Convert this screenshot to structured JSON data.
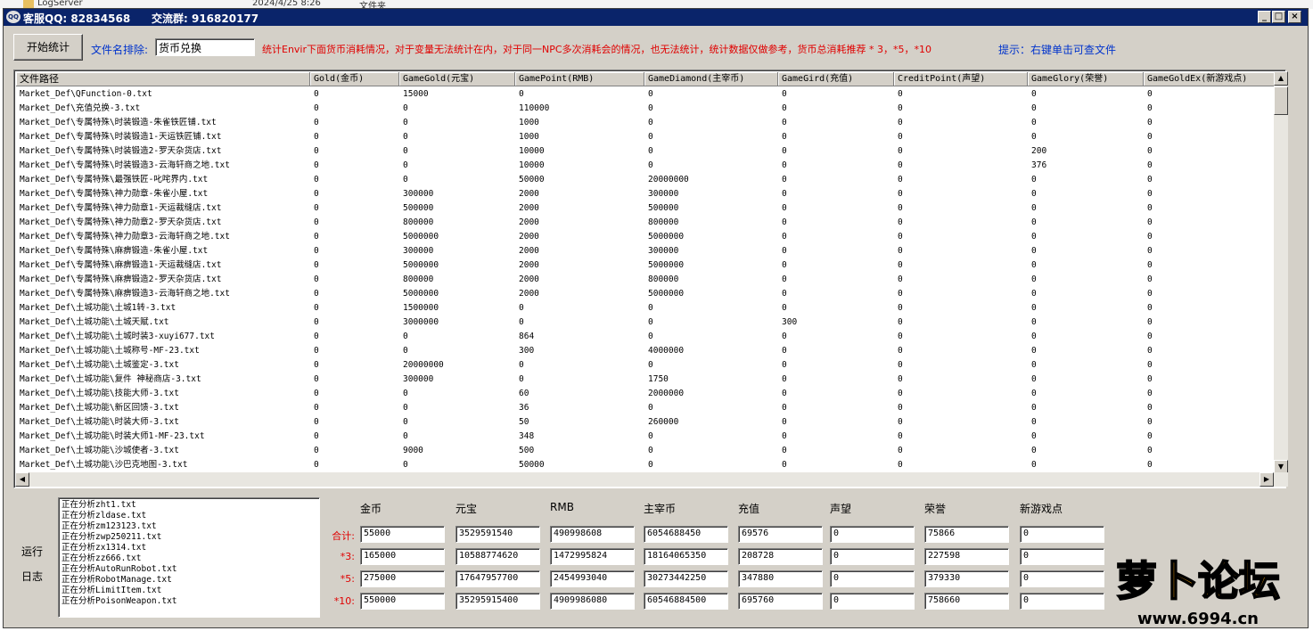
{
  "background": {
    "filename": "LogServer",
    "date": "2024/4/25 8:26",
    "type": "文件夹"
  },
  "titlebar": {
    "service_qq": "客服QQ: 82834568",
    "group": "交流群: 916820177",
    "min": "_",
    "max": "□",
    "close": "×"
  },
  "toolbar": {
    "start_label": "开始统计",
    "exclude_label": "文件名排除:",
    "exclude_value": "货币兑换",
    "note": "统计Envir下面货币消耗情况，对于变量无法统计在内，对于同一NPC多次消耗会的情况，也无法统计，统计数据仅做参考，货币总消耗推荐 * 3，*5，*10",
    "hint": "提示：右键单击可查文件"
  },
  "grid": {
    "columns": [
      "文件路径",
      "Gold(金币)",
      "GameGold(元宝)",
      "GamePoint(RMB)",
      "GameDiamond(主宰币)",
      "GameGird(充值)",
      "CreditPoint(声望)",
      "GameGlory(荣誉)",
      "GameGoldEx(新游戏点)"
    ],
    "rows": [
      [
        "Market_Def\\QFunction-0.txt",
        "0",
        "15000",
        "0",
        "0",
        "0",
        "0",
        "0",
        "0"
      ],
      [
        "Market_Def\\充值兑换-3.txt",
        "0",
        "0",
        "110000",
        "0",
        "0",
        "0",
        "0",
        "0"
      ],
      [
        "Market_Def\\专属特殊\\时装锻造-朱雀铁匠铺.txt",
        "0",
        "0",
        "1000",
        "0",
        "0",
        "0",
        "0",
        "0"
      ],
      [
        "Market_Def\\专属特殊\\时装锻造1-天运铁匠铺.txt",
        "0",
        "0",
        "1000",
        "0",
        "0",
        "0",
        "0",
        "0"
      ],
      [
        "Market_Def\\专属特殊\\时装锻造2-罗天杂货店.txt",
        "0",
        "0",
        "10000",
        "0",
        "0",
        "0",
        "200",
        "0"
      ],
      [
        "Market_Def\\专属特殊\\时装锻造3-云海轩商之地.txt",
        "0",
        "0",
        "10000",
        "0",
        "0",
        "0",
        "376",
        "0"
      ],
      [
        "Market_Def\\专属特殊\\最强铁匠-叱咤界内.txt",
        "0",
        "0",
        "50000",
        "20000000",
        "0",
        "0",
        "0",
        "0"
      ],
      [
        "Market_Def\\专属特殊\\神力勋章-朱雀小屋.txt",
        "0",
        "300000",
        "2000",
        "300000",
        "0",
        "0",
        "0",
        "0"
      ],
      [
        "Market_Def\\专属特殊\\神力勋章1-天运裁缝店.txt",
        "0",
        "500000",
        "2000",
        "500000",
        "0",
        "0",
        "0",
        "0"
      ],
      [
        "Market_Def\\专属特殊\\神力勋章2-罗天杂货店.txt",
        "0",
        "800000",
        "2000",
        "800000",
        "0",
        "0",
        "0",
        "0"
      ],
      [
        "Market_Def\\专属特殊\\神力勋章3-云海轩商之地.txt",
        "0",
        "5000000",
        "2000",
        "5000000",
        "0",
        "0",
        "0",
        "0"
      ],
      [
        "Market_Def\\专属特殊\\麻痹锻造-朱雀小屋.txt",
        "0",
        "300000",
        "2000",
        "300000",
        "0",
        "0",
        "0",
        "0"
      ],
      [
        "Market_Def\\专属特殊\\麻痹锻造1-天运裁缝店.txt",
        "0",
        "5000000",
        "2000",
        "5000000",
        "0",
        "0",
        "0",
        "0"
      ],
      [
        "Market_Def\\专属特殊\\麻痹锻造2-罗天杂货店.txt",
        "0",
        "800000",
        "2000",
        "800000",
        "0",
        "0",
        "0",
        "0"
      ],
      [
        "Market_Def\\专属特殊\\麻痹锻造3-云海轩商之地.txt",
        "0",
        "5000000",
        "2000",
        "5000000",
        "0",
        "0",
        "0",
        "0"
      ],
      [
        "Market_Def\\土城功能\\土城1转-3.txt",
        "0",
        "1500000",
        "0",
        "0",
        "0",
        "0",
        "0",
        "0"
      ],
      [
        "Market_Def\\土城功能\\土城天赋.txt",
        "0",
        "3000000",
        "0",
        "0",
        "300",
        "0",
        "0",
        "0"
      ],
      [
        "Market_Def\\土城功能\\土城时装3-xuyi677.txt",
        "0",
        "0",
        "864",
        "0",
        "0",
        "0",
        "0",
        "0"
      ],
      [
        "Market_Def\\土城功能\\土城称号-MF-23.txt",
        "0",
        "0",
        "300",
        "4000000",
        "0",
        "0",
        "0",
        "0"
      ],
      [
        "Market_Def\\土城功能\\土城鉴定-3.txt",
        "0",
        "20000000",
        "0",
        "0",
        "0",
        "0",
        "0",
        "0"
      ],
      [
        "Market_Def\\土城功能\\复件 神秘商店-3.txt",
        "0",
        "300000",
        "0",
        "1750",
        "0",
        "0",
        "0",
        "0"
      ],
      [
        "Market_Def\\土城功能\\技能大师-3.txt",
        "0",
        "0",
        "60",
        "2000000",
        "0",
        "0",
        "0",
        "0"
      ],
      [
        "Market_Def\\土城功能\\新区回馈-3.txt",
        "0",
        "0",
        "36",
        "0",
        "0",
        "0",
        "0",
        "0"
      ],
      [
        "Market_Def\\土城功能\\时装大师-3.txt",
        "0",
        "0",
        "50",
        "260000",
        "0",
        "0",
        "0",
        "0"
      ],
      [
        "Market_Def\\土城功能\\时装大师1-MF-23.txt",
        "0",
        "0",
        "348",
        "0",
        "0",
        "0",
        "0",
        "0"
      ],
      [
        "Market_Def\\土城功能\\沙城使者-3.txt",
        "0",
        "9000",
        "500",
        "0",
        "0",
        "0",
        "0",
        "0"
      ],
      [
        "Market_Def\\土城功能\\沙巴克地图-3.txt",
        "0",
        "0",
        "50000",
        "0",
        "0",
        "0",
        "0",
        "0"
      ]
    ]
  },
  "log": {
    "label_run": "运行",
    "label_log": "日志",
    "lines": [
      "正在分析zht1.txt",
      "正在分析zldase.txt",
      "正在分析zm123123.txt",
      "正在分析zwp250211.txt",
      "正在分析zx1314.txt",
      "正在分析zz666.txt",
      "正在分析AutoRunRobot.txt",
      "正在分析RobotManage.txt",
      "正在分析LimitItem.txt",
      "正在分析PoisonWeapon.txt"
    ]
  },
  "summary": {
    "headers": [
      "金币",
      "元宝",
      "RMB",
      "主宰币",
      "充值",
      "声望",
      "荣誉",
      "新游戏点"
    ],
    "rows": [
      {
        "label": "合计:",
        "values": [
          "55000",
          "3529591540",
          "490998608",
          "6054688450",
          "69576",
          "0",
          "75866",
          "0"
        ]
      },
      {
        "label": "*3:",
        "values": [
          "165000",
          "10588774620",
          "1472995824",
          "18164065350",
          "208728",
          "0",
          "227598",
          "0"
        ]
      },
      {
        "label": "*5:",
        "values": [
          "275000",
          "17647957700",
          "2454993040",
          "30273442250",
          "347880",
          "0",
          "379330",
          "0"
        ]
      },
      {
        "label": "*10:",
        "values": [
          "550000",
          "35295915400",
          "4909986080",
          "60546884500",
          "695760",
          "0",
          "758660",
          "0"
        ]
      }
    ]
  },
  "watermark": {
    "title": "萝卜论坛",
    "url": "www.6994.cn"
  }
}
